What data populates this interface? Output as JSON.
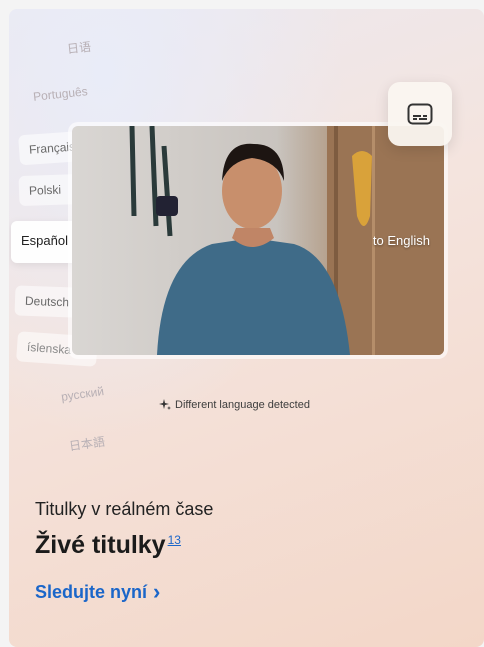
{
  "languages": [
    {
      "label": "日语",
      "style": "faded"
    },
    {
      "label": "Português",
      "style": "faded"
    },
    {
      "label": "Français",
      "style": "mid"
    },
    {
      "label": "Polski",
      "style": "mid"
    },
    {
      "label": "Español",
      "style": "active"
    },
    {
      "label": "Deutsch",
      "style": "mid"
    },
    {
      "label": "íslenska",
      "style": "mid"
    },
    {
      "label": "русский",
      "style": "faded"
    },
    {
      "label": "日本語",
      "style": "faded"
    }
  ],
  "video": {
    "caption": "to English"
  },
  "detected_text": "Different language detected",
  "subtitle": "Titulky v reálném čase",
  "title": "Živé titulky",
  "footnote": "13",
  "link": {
    "label": "Sledujte nyní",
    "arrow": "›"
  },
  "colors": {
    "accent": "#1b66c9",
    "text": "#1b1b1b"
  },
  "icons": {
    "captions": "closed-captions-icon",
    "sparkle": "sparkle-icon",
    "chevron": "chevron-right-icon"
  }
}
